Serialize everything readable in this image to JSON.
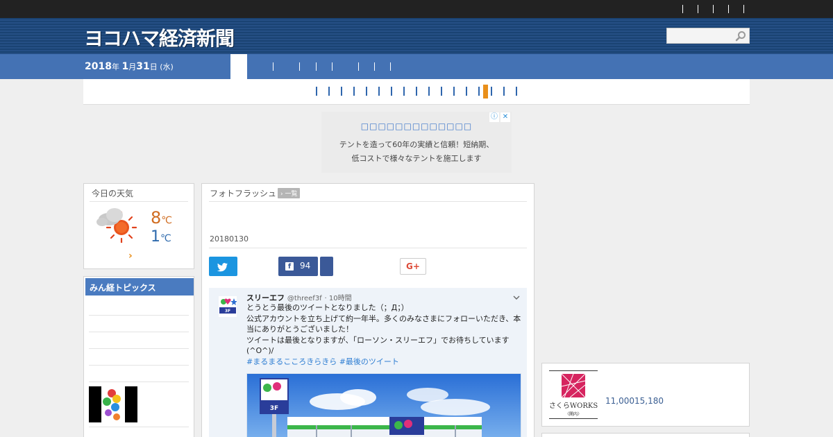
{
  "site": {
    "title": "ヨコハマ経済新聞",
    "search": {
      "placeholder": ""
    }
  },
  "date": {
    "year": "2018",
    "year_unit": "年 ",
    "month": "1",
    "month_unit": "月",
    "day": "31",
    "day_unit": "日 ",
    "weekday": "(水)"
  },
  "ad_top": {
    "title": "□□□□□□□□□□□□□",
    "line1": "テントを造って60年の実績と信頼！短納期、",
    "line2": "低コストで様々なテントを施工します",
    "info_icon": "info-icon",
    "close_icon": "close-icon"
  },
  "weather": {
    "title": "今日の天気",
    "high": "8",
    "low": "1",
    "unit": "℃",
    "more": "›",
    "icon": "cloudy-sunny-icon"
  },
  "topics": {
    "title": "みん経トピックス"
  },
  "photo_flash": {
    "heading": "フォトフラッシュ",
    "list_label": "一覧",
    "date": "20180130"
  },
  "share": {
    "twitter_icon": "twitter-icon",
    "facebook_count": "94",
    "google_plus": "G+"
  },
  "tweet": {
    "name": "スリーエフ",
    "handle": "@threef3f",
    "time": "· 10時間",
    "line1": "とうとう最後のツイートとなりました（；Д；）",
    "line2": "公式アカウントを立ち上げて約一年半。多くのみなさまにフォローいただき、本当にありがとうございました！",
    "line3": "ツイートは最後となりますが、「ローソン・スリーエフ」でお待ちしています(^O^)/",
    "hashtags": "#まるまるこころきらきら #最後のツイート"
  },
  "ad_right": {
    "brand": "さくらWORKS",
    "brand_sub": "〈関内〉",
    "numbers": "11,00015,180"
  },
  "colors": {
    "header_blue": "#1f4a7d",
    "nav_blue": "#4472b4",
    "accent_orange": "#e98f1a",
    "twitter": "#1b95e0",
    "facebook": "#3b5998",
    "google_plus": "#dd4b39"
  }
}
